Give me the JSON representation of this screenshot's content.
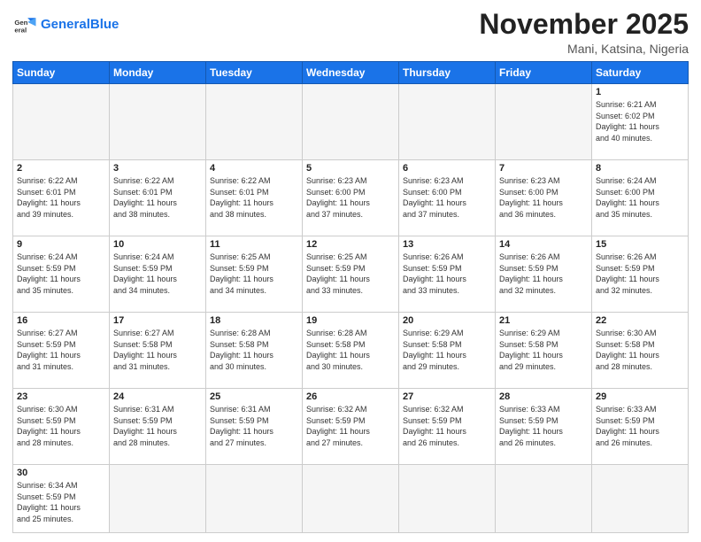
{
  "header": {
    "logo_general": "General",
    "logo_blue": "Blue",
    "month_title": "November 2025",
    "location": "Mani, Katsina, Nigeria"
  },
  "weekdays": [
    "Sunday",
    "Monday",
    "Tuesday",
    "Wednesday",
    "Thursday",
    "Friday",
    "Saturday"
  ],
  "weeks": [
    [
      {
        "day": "",
        "info": ""
      },
      {
        "day": "",
        "info": ""
      },
      {
        "day": "",
        "info": ""
      },
      {
        "day": "",
        "info": ""
      },
      {
        "day": "",
        "info": ""
      },
      {
        "day": "",
        "info": ""
      },
      {
        "day": "1",
        "info": "Sunrise: 6:21 AM\nSunset: 6:02 PM\nDaylight: 11 hours\nand 40 minutes."
      }
    ],
    [
      {
        "day": "2",
        "info": "Sunrise: 6:22 AM\nSunset: 6:01 PM\nDaylight: 11 hours\nand 39 minutes."
      },
      {
        "day": "3",
        "info": "Sunrise: 6:22 AM\nSunset: 6:01 PM\nDaylight: 11 hours\nand 38 minutes."
      },
      {
        "day": "4",
        "info": "Sunrise: 6:22 AM\nSunset: 6:01 PM\nDaylight: 11 hours\nand 38 minutes."
      },
      {
        "day": "5",
        "info": "Sunrise: 6:23 AM\nSunset: 6:00 PM\nDaylight: 11 hours\nand 37 minutes."
      },
      {
        "day": "6",
        "info": "Sunrise: 6:23 AM\nSunset: 6:00 PM\nDaylight: 11 hours\nand 37 minutes."
      },
      {
        "day": "7",
        "info": "Sunrise: 6:23 AM\nSunset: 6:00 PM\nDaylight: 11 hours\nand 36 minutes."
      },
      {
        "day": "8",
        "info": "Sunrise: 6:24 AM\nSunset: 6:00 PM\nDaylight: 11 hours\nand 35 minutes."
      }
    ],
    [
      {
        "day": "9",
        "info": "Sunrise: 6:24 AM\nSunset: 5:59 PM\nDaylight: 11 hours\nand 35 minutes."
      },
      {
        "day": "10",
        "info": "Sunrise: 6:24 AM\nSunset: 5:59 PM\nDaylight: 11 hours\nand 34 minutes."
      },
      {
        "day": "11",
        "info": "Sunrise: 6:25 AM\nSunset: 5:59 PM\nDaylight: 11 hours\nand 34 minutes."
      },
      {
        "day": "12",
        "info": "Sunrise: 6:25 AM\nSunset: 5:59 PM\nDaylight: 11 hours\nand 33 minutes."
      },
      {
        "day": "13",
        "info": "Sunrise: 6:26 AM\nSunset: 5:59 PM\nDaylight: 11 hours\nand 33 minutes."
      },
      {
        "day": "14",
        "info": "Sunrise: 6:26 AM\nSunset: 5:59 PM\nDaylight: 11 hours\nand 32 minutes."
      },
      {
        "day": "15",
        "info": "Sunrise: 6:26 AM\nSunset: 5:59 PM\nDaylight: 11 hours\nand 32 minutes."
      }
    ],
    [
      {
        "day": "16",
        "info": "Sunrise: 6:27 AM\nSunset: 5:59 PM\nDaylight: 11 hours\nand 31 minutes."
      },
      {
        "day": "17",
        "info": "Sunrise: 6:27 AM\nSunset: 5:58 PM\nDaylight: 11 hours\nand 31 minutes."
      },
      {
        "day": "18",
        "info": "Sunrise: 6:28 AM\nSunset: 5:58 PM\nDaylight: 11 hours\nand 30 minutes."
      },
      {
        "day": "19",
        "info": "Sunrise: 6:28 AM\nSunset: 5:58 PM\nDaylight: 11 hours\nand 30 minutes."
      },
      {
        "day": "20",
        "info": "Sunrise: 6:29 AM\nSunset: 5:58 PM\nDaylight: 11 hours\nand 29 minutes."
      },
      {
        "day": "21",
        "info": "Sunrise: 6:29 AM\nSunset: 5:58 PM\nDaylight: 11 hours\nand 29 minutes."
      },
      {
        "day": "22",
        "info": "Sunrise: 6:30 AM\nSunset: 5:58 PM\nDaylight: 11 hours\nand 28 minutes."
      }
    ],
    [
      {
        "day": "23",
        "info": "Sunrise: 6:30 AM\nSunset: 5:59 PM\nDaylight: 11 hours\nand 28 minutes."
      },
      {
        "day": "24",
        "info": "Sunrise: 6:31 AM\nSunset: 5:59 PM\nDaylight: 11 hours\nand 28 minutes."
      },
      {
        "day": "25",
        "info": "Sunrise: 6:31 AM\nSunset: 5:59 PM\nDaylight: 11 hours\nand 27 minutes."
      },
      {
        "day": "26",
        "info": "Sunrise: 6:32 AM\nSunset: 5:59 PM\nDaylight: 11 hours\nand 27 minutes."
      },
      {
        "day": "27",
        "info": "Sunrise: 6:32 AM\nSunset: 5:59 PM\nDaylight: 11 hours\nand 26 minutes."
      },
      {
        "day": "28",
        "info": "Sunrise: 6:33 AM\nSunset: 5:59 PM\nDaylight: 11 hours\nand 26 minutes."
      },
      {
        "day": "29",
        "info": "Sunrise: 6:33 AM\nSunset: 5:59 PM\nDaylight: 11 hours\nand 26 minutes."
      }
    ],
    [
      {
        "day": "30",
        "info": "Sunrise: 6:34 AM\nSunset: 5:59 PM\nDaylight: 11 hours\nand 25 minutes."
      },
      {
        "day": "",
        "info": ""
      },
      {
        "day": "",
        "info": ""
      },
      {
        "day": "",
        "info": ""
      },
      {
        "day": "",
        "info": ""
      },
      {
        "day": "",
        "info": ""
      },
      {
        "day": "",
        "info": ""
      }
    ]
  ]
}
